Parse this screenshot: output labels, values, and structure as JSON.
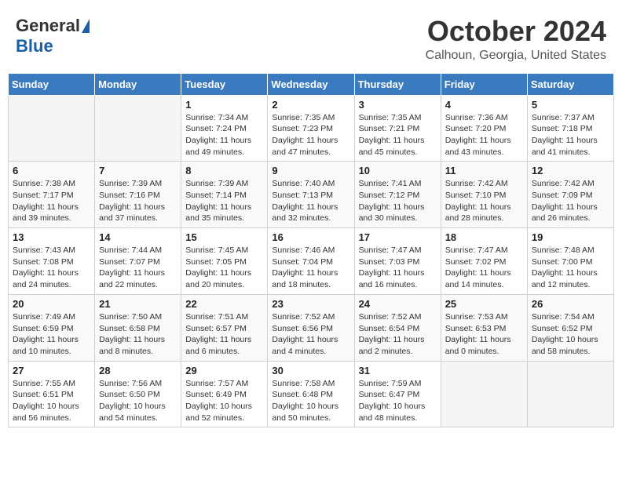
{
  "logo": {
    "general": "General",
    "blue": "Blue"
  },
  "header": {
    "month": "October 2024",
    "location": "Calhoun, Georgia, United States"
  },
  "weekdays": [
    "Sunday",
    "Monday",
    "Tuesday",
    "Wednesday",
    "Thursday",
    "Friday",
    "Saturday"
  ],
  "weeks": [
    [
      {
        "day": "",
        "info": ""
      },
      {
        "day": "",
        "info": ""
      },
      {
        "day": "1",
        "info": "Sunrise: 7:34 AM\nSunset: 7:24 PM\nDaylight: 11 hours and 49 minutes."
      },
      {
        "day": "2",
        "info": "Sunrise: 7:35 AM\nSunset: 7:23 PM\nDaylight: 11 hours and 47 minutes."
      },
      {
        "day": "3",
        "info": "Sunrise: 7:35 AM\nSunset: 7:21 PM\nDaylight: 11 hours and 45 minutes."
      },
      {
        "day": "4",
        "info": "Sunrise: 7:36 AM\nSunset: 7:20 PM\nDaylight: 11 hours and 43 minutes."
      },
      {
        "day": "5",
        "info": "Sunrise: 7:37 AM\nSunset: 7:18 PM\nDaylight: 11 hours and 41 minutes."
      }
    ],
    [
      {
        "day": "6",
        "info": "Sunrise: 7:38 AM\nSunset: 7:17 PM\nDaylight: 11 hours and 39 minutes."
      },
      {
        "day": "7",
        "info": "Sunrise: 7:39 AM\nSunset: 7:16 PM\nDaylight: 11 hours and 37 minutes."
      },
      {
        "day": "8",
        "info": "Sunrise: 7:39 AM\nSunset: 7:14 PM\nDaylight: 11 hours and 35 minutes."
      },
      {
        "day": "9",
        "info": "Sunrise: 7:40 AM\nSunset: 7:13 PM\nDaylight: 11 hours and 32 minutes."
      },
      {
        "day": "10",
        "info": "Sunrise: 7:41 AM\nSunset: 7:12 PM\nDaylight: 11 hours and 30 minutes."
      },
      {
        "day": "11",
        "info": "Sunrise: 7:42 AM\nSunset: 7:10 PM\nDaylight: 11 hours and 28 minutes."
      },
      {
        "day": "12",
        "info": "Sunrise: 7:42 AM\nSunset: 7:09 PM\nDaylight: 11 hours and 26 minutes."
      }
    ],
    [
      {
        "day": "13",
        "info": "Sunrise: 7:43 AM\nSunset: 7:08 PM\nDaylight: 11 hours and 24 minutes."
      },
      {
        "day": "14",
        "info": "Sunrise: 7:44 AM\nSunset: 7:07 PM\nDaylight: 11 hours and 22 minutes."
      },
      {
        "day": "15",
        "info": "Sunrise: 7:45 AM\nSunset: 7:05 PM\nDaylight: 11 hours and 20 minutes."
      },
      {
        "day": "16",
        "info": "Sunrise: 7:46 AM\nSunset: 7:04 PM\nDaylight: 11 hours and 18 minutes."
      },
      {
        "day": "17",
        "info": "Sunrise: 7:47 AM\nSunset: 7:03 PM\nDaylight: 11 hours and 16 minutes."
      },
      {
        "day": "18",
        "info": "Sunrise: 7:47 AM\nSunset: 7:02 PM\nDaylight: 11 hours and 14 minutes."
      },
      {
        "day": "19",
        "info": "Sunrise: 7:48 AM\nSunset: 7:00 PM\nDaylight: 11 hours and 12 minutes."
      }
    ],
    [
      {
        "day": "20",
        "info": "Sunrise: 7:49 AM\nSunset: 6:59 PM\nDaylight: 11 hours and 10 minutes."
      },
      {
        "day": "21",
        "info": "Sunrise: 7:50 AM\nSunset: 6:58 PM\nDaylight: 11 hours and 8 minutes."
      },
      {
        "day": "22",
        "info": "Sunrise: 7:51 AM\nSunset: 6:57 PM\nDaylight: 11 hours and 6 minutes."
      },
      {
        "day": "23",
        "info": "Sunrise: 7:52 AM\nSunset: 6:56 PM\nDaylight: 11 hours and 4 minutes."
      },
      {
        "day": "24",
        "info": "Sunrise: 7:52 AM\nSunset: 6:54 PM\nDaylight: 11 hours and 2 minutes."
      },
      {
        "day": "25",
        "info": "Sunrise: 7:53 AM\nSunset: 6:53 PM\nDaylight: 11 hours and 0 minutes."
      },
      {
        "day": "26",
        "info": "Sunrise: 7:54 AM\nSunset: 6:52 PM\nDaylight: 10 hours and 58 minutes."
      }
    ],
    [
      {
        "day": "27",
        "info": "Sunrise: 7:55 AM\nSunset: 6:51 PM\nDaylight: 10 hours and 56 minutes."
      },
      {
        "day": "28",
        "info": "Sunrise: 7:56 AM\nSunset: 6:50 PM\nDaylight: 10 hours and 54 minutes."
      },
      {
        "day": "29",
        "info": "Sunrise: 7:57 AM\nSunset: 6:49 PM\nDaylight: 10 hours and 52 minutes."
      },
      {
        "day": "30",
        "info": "Sunrise: 7:58 AM\nSunset: 6:48 PM\nDaylight: 10 hours and 50 minutes."
      },
      {
        "day": "31",
        "info": "Sunrise: 7:59 AM\nSunset: 6:47 PM\nDaylight: 10 hours and 48 minutes."
      },
      {
        "day": "",
        "info": ""
      },
      {
        "day": "",
        "info": ""
      }
    ]
  ]
}
